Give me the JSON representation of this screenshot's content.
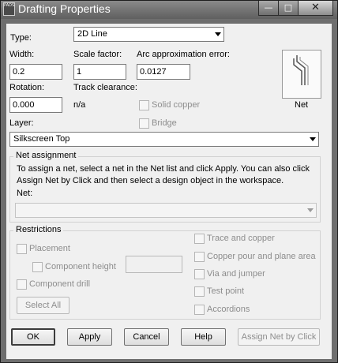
{
  "window": {
    "title": "Drafting Properties",
    "app_icon_text": "PADS",
    "buttons": {
      "minimize": "—",
      "maximize": "□",
      "close": "✕"
    }
  },
  "type": {
    "label": "Type:",
    "value": "2D Line"
  },
  "width": {
    "label": "Width:",
    "value": "0.2"
  },
  "scale": {
    "label": "Scale factor:",
    "value": "1"
  },
  "arc": {
    "label": "Arc approximation error:",
    "value": "0.0127"
  },
  "net_tile": {
    "label": "Net"
  },
  "rotation": {
    "label": "Rotation:",
    "value": "0.000"
  },
  "track": {
    "label": "Track clearance:",
    "value": "n/a"
  },
  "solid_copper": {
    "label": "Solid copper",
    "checked": false
  },
  "bridge": {
    "label": "Bridge",
    "checked": false
  },
  "layer": {
    "label": "Layer:",
    "value": "Silkscreen Top"
  },
  "net_assignment": {
    "title": "Net assignment",
    "instructions_line1": "To assign a net, select a net in the Net list and click Apply. You can also click",
    "instructions_line2": "Assign Net by Click and then select a design object in the workspace.",
    "net_label": "Net:",
    "net_value": ""
  },
  "restrictions": {
    "title": "Restrictions",
    "placement": "Placement",
    "component_height": "Component height",
    "component_height_value": "",
    "component_drill": "Component drill",
    "select_all": "Select All",
    "trace_copper": "Trace and copper",
    "copper_pour": "Copper pour and plane area",
    "via_jumper": "Via and jumper",
    "test_point": "Test point",
    "accordions": "Accordions"
  },
  "footer": {
    "ok": "OK",
    "apply": "Apply",
    "cancel": "Cancel",
    "help": "Help",
    "assign_net": "Assign Net by Click"
  }
}
